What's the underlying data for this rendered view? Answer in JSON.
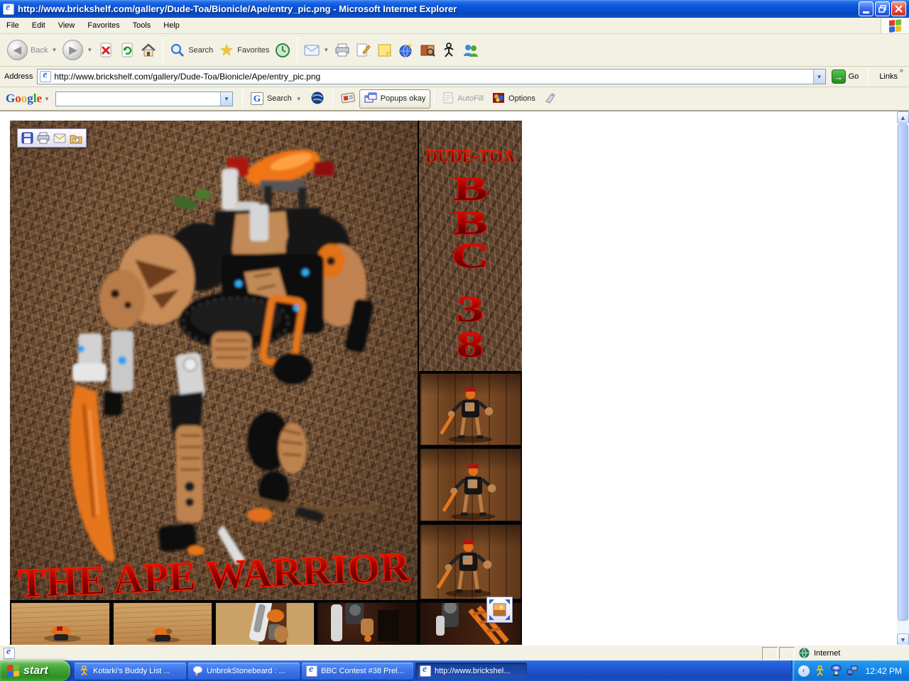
{
  "window": {
    "title": "http://www.brickshelf.com/gallery/Dude-Toa/Bionicle/Ape/entry_pic.png - Microsoft Internet Explorer"
  },
  "menu": {
    "items": [
      "File",
      "Edit",
      "View",
      "Favorites",
      "Tools",
      "Help"
    ]
  },
  "toolbar": {
    "back": "Back",
    "search": "Search",
    "favorites": "Favorites"
  },
  "address_bar": {
    "label": "Address",
    "value": "http://www.brickshelf.com/gallery/Dude-Toa/Bionicle/Ape/entry_pic.png",
    "go_label": "Go",
    "links_label": "Links",
    "overflow_chevron": "»"
  },
  "google_toolbar": {
    "logo_letters": [
      "G",
      "o",
      "o",
      "g",
      "l",
      "e"
    ],
    "g_icon": "G",
    "search_label": "Search",
    "popups_label": "Popups okay",
    "autofill_label": "AutoFill",
    "options_label": "Options",
    "search_value": ""
  },
  "content": {
    "collage": {
      "builder": "DUDE-TOA",
      "bbc_letters": [
        "B",
        "B",
        "C"
      ],
      "contest_digits": [
        "3",
        "8"
      ],
      "title": "THE APE WARRIOR"
    }
  },
  "status_bar": {
    "zone": "Internet"
  },
  "taskbar": {
    "start_label": "start",
    "windows": [
      {
        "label": "Kotarki's Buddy List ...",
        "icon": "aim-icon"
      },
      {
        "label": "UnbrokStonebeard : ...",
        "icon": "chat-icon"
      },
      {
        "label": "BBC Contest #38 Prel...",
        "icon": "ie-icon"
      },
      {
        "label": "http://www.brickshel...",
        "icon": "ie-icon",
        "active": true
      }
    ],
    "clock": "12:42 PM"
  },
  "icons": {
    "stop": "✖",
    "refresh": "↻",
    "favorites_star": "★",
    "dropdown_caret": "▼",
    "go_arrow": "→",
    "links_chevron": "»",
    "scroll_up": "∧",
    "scroll_down": "∨",
    "tray_chevron": "‹"
  },
  "colors": {
    "titlebar_blue": "#0c59e0",
    "taskbar_blue": "#1f55cf",
    "start_green": "#2e8f26",
    "collage_red": "#cc0c00",
    "bionicle_orange": "#e5761c",
    "xp_face": "#f3f1e4"
  }
}
